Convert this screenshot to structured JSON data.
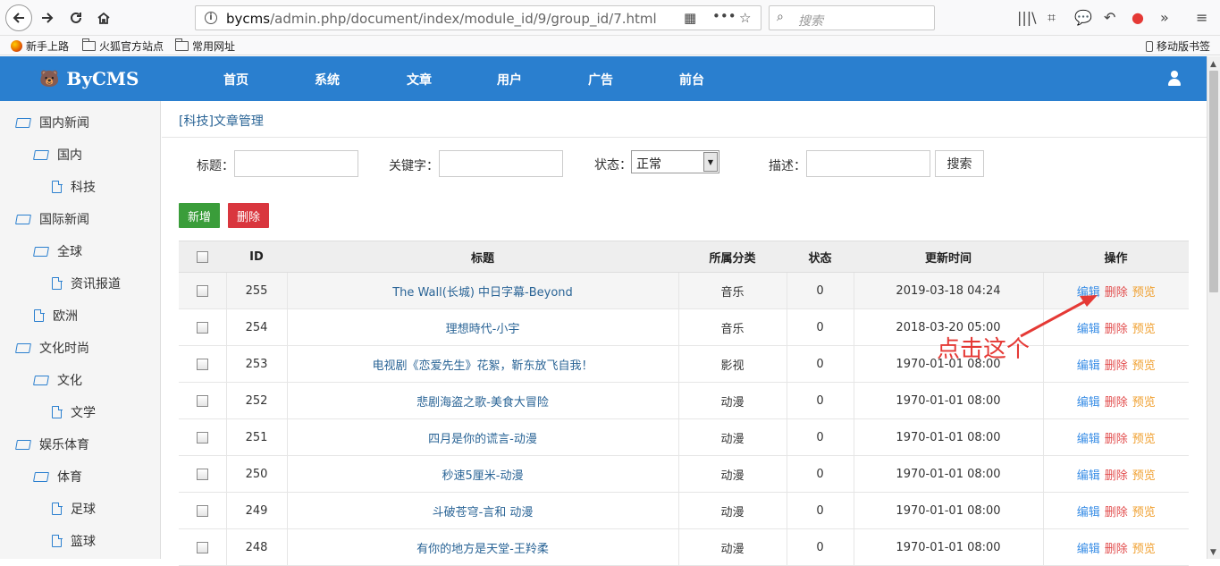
{
  "browser": {
    "url_host": "bycms",
    "url_path": "/admin.php/document/index/module_id/9/group_id/7.html",
    "search_placeholder": "搜索",
    "bookmarks": [
      "新手上路",
      "火狐官方站点",
      "常用网址"
    ],
    "mobile_bookmarks": "移动版书签"
  },
  "app": {
    "logo": "ByCMS",
    "nav": [
      "首页",
      "系统",
      "文章",
      "用户",
      "广告",
      "前台"
    ]
  },
  "sidebar": {
    "items": [
      {
        "label": "国内新闻",
        "type": "folder",
        "level": 0
      },
      {
        "label": "国内",
        "type": "folder",
        "level": 1
      },
      {
        "label": "科技",
        "type": "file",
        "level": 2
      },
      {
        "label": "国际新闻",
        "type": "folder",
        "level": 0
      },
      {
        "label": "全球",
        "type": "folder",
        "level": 1
      },
      {
        "label": "资讯报道",
        "type": "file",
        "level": 2
      },
      {
        "label": "欧洲",
        "type": "file",
        "level": 1
      },
      {
        "label": "文化时尚",
        "type": "folder",
        "level": 0
      },
      {
        "label": "文化",
        "type": "folder",
        "level": 1
      },
      {
        "label": "文学",
        "type": "file",
        "level": 2
      },
      {
        "label": "娱乐体育",
        "type": "folder",
        "level": 0
      },
      {
        "label": "体育",
        "type": "folder",
        "level": 1
      },
      {
        "label": "足球",
        "type": "file",
        "level": 2
      },
      {
        "label": "篮球",
        "type": "file",
        "level": 2
      }
    ]
  },
  "main": {
    "breadcrumb": "[科技]文章管理",
    "filters": {
      "title_label": "标题：",
      "keyword_label": "关键字：",
      "status_label": "状态：",
      "status_value": "正常",
      "desc_label": "描述：",
      "search_button": "搜索"
    },
    "add_button": "新增",
    "delete_button": "删除",
    "table": {
      "headers": [
        "ID",
        "标题",
        "所属分类",
        "状态",
        "更新时间",
        "操作"
      ],
      "rows": [
        {
          "id": "255",
          "title": "The Wall(长城) 中日字幕-Beyond",
          "category": "音乐",
          "status": "0",
          "updated": "2019-03-18 04:24"
        },
        {
          "id": "254",
          "title": "理想時代-小宇",
          "category": "音乐",
          "status": "0",
          "updated": "2018-03-20 05:00"
        },
        {
          "id": "253",
          "title": "电视剧《恋爱先生》花絮，靳东放飞自我！",
          "category": "影视",
          "status": "0",
          "updated": "1970-01-01 08:00"
        },
        {
          "id": "252",
          "title": "悲剧海盗之歌-美食大冒险",
          "category": "动漫",
          "status": "0",
          "updated": "1970-01-01 08:00"
        },
        {
          "id": "251",
          "title": "四月是你的谎言-动漫",
          "category": "动漫",
          "status": "0",
          "updated": "1970-01-01 08:00"
        },
        {
          "id": "250",
          "title": "秒速5厘米-动漫",
          "category": "动漫",
          "status": "0",
          "updated": "1970-01-01 08:00"
        },
        {
          "id": "249",
          "title": "斗破苍穹-言和 动漫",
          "category": "动漫",
          "status": "0",
          "updated": "1970-01-01 08:00"
        },
        {
          "id": "248",
          "title": "有你的地方是天堂-王羚柔",
          "category": "动漫",
          "status": "0",
          "updated": "1970-01-01 08:00"
        }
      ],
      "ops": {
        "edit": "编辑",
        "delete": "删除",
        "preview": "预览"
      }
    },
    "annotation": "点击这个"
  },
  "colors": {
    "header": "#2a7fcf",
    "add": "#3a9d3a",
    "delete": "#d9363e",
    "annotation": "#e53935"
  }
}
